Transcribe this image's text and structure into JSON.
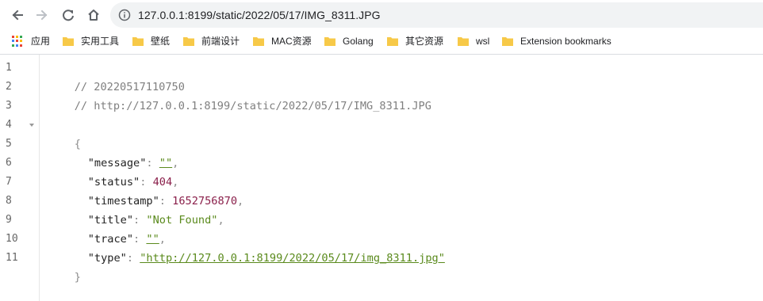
{
  "browser": {
    "url_text": "127.0.0.1:8199/static/2022/05/17/IMG_8311.JPG",
    "icons": {
      "back": "arrow-left-icon",
      "forward": "arrow-right-icon",
      "reload": "reload-icon",
      "home": "home-icon",
      "site_info": "info-icon"
    }
  },
  "bookmarks": {
    "apps_label": "应用",
    "items": [
      {
        "label": "实用工具"
      },
      {
        "label": "壁纸"
      },
      {
        "label": "前端设计"
      },
      {
        "label": "MAC资源"
      },
      {
        "label": "Golang"
      },
      {
        "label": "其它资源"
      },
      {
        "label": "wsl"
      },
      {
        "label": "Extension bookmarks"
      }
    ]
  },
  "viewer": {
    "line_numbers": [
      "1",
      "2",
      "3",
      "4",
      "5",
      "6",
      "7",
      "8",
      "9",
      "10",
      "11"
    ],
    "comment_timestamp": "// 20220517110750",
    "comment_url": "// http://127.0.0.1:8199/static/2022/05/17/IMG_8311.JPG",
    "open_brace": "{",
    "close_brace": "}",
    "entries": [
      {
        "key": "\"message\"",
        "value": "\"\"",
        "value_type": "link",
        "trailing": ","
      },
      {
        "key": "\"status\"",
        "value": "404",
        "value_type": "number",
        "trailing": ","
      },
      {
        "key": "\"timestamp\"",
        "value": "1652756870",
        "value_type": "number",
        "trailing": ","
      },
      {
        "key": "\"title\"",
        "value": "\"Not Found\"",
        "value_type": "string",
        "trailing": ","
      },
      {
        "key": "\"trace\"",
        "value": "\"\"",
        "value_type": "link",
        "trailing": ","
      },
      {
        "key": "\"type\"",
        "value": "\"http://127.0.0.1:8199/2022/05/17/img_8311.jpg\"",
        "value_type": "link",
        "trailing": ""
      }
    ],
    "colon": ": "
  },
  "colors": {
    "string": "#5a8a1c",
    "number": "#8a1f4a",
    "comment": "#7f7f7f",
    "folder": "#f7c948"
  }
}
